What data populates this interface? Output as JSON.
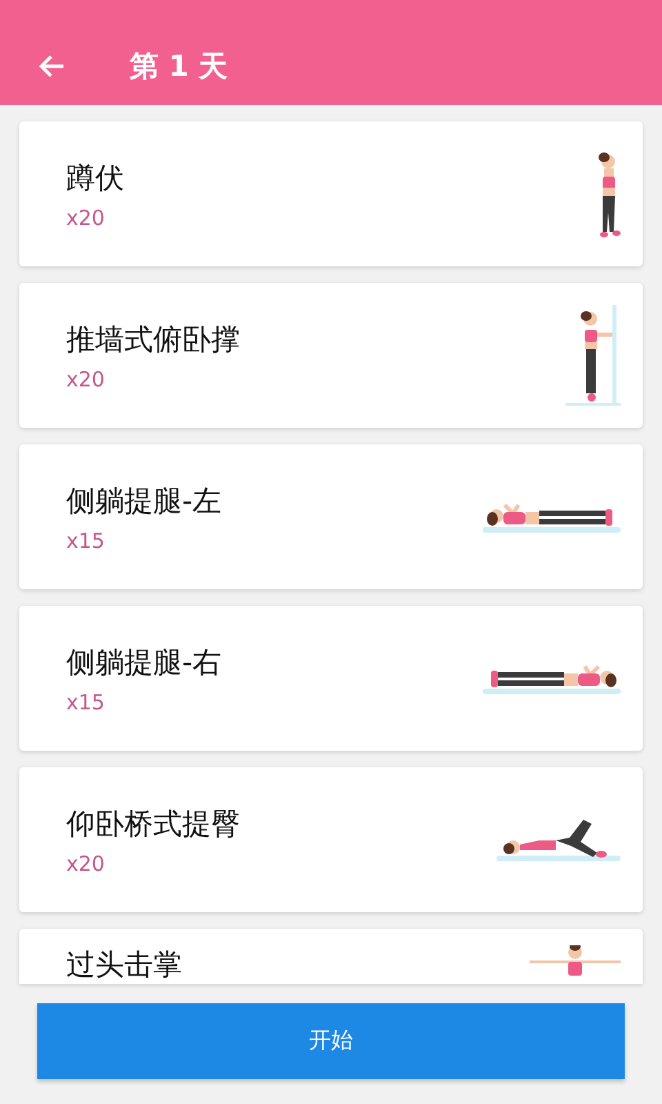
{
  "header": {
    "title": "第 1 天"
  },
  "exercises": [
    {
      "name": "蹲伏",
      "count": "x20",
      "kind": "standing"
    },
    {
      "name": "推墙式俯卧撑",
      "count": "x20",
      "kind": "wall"
    },
    {
      "name": "侧躺提腿-左",
      "count": "x15",
      "kind": "side-left"
    },
    {
      "name": "侧躺提腿-右",
      "count": "x15",
      "kind": "side-right"
    },
    {
      "name": "仰卧桥式提臀",
      "count": "x20",
      "kind": "bridge"
    },
    {
      "name": "过头击掌",
      "kind": "arms-out"
    }
  ],
  "start_button": {
    "label": "开始"
  }
}
